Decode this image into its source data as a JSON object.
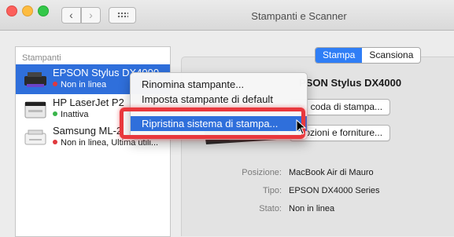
{
  "window": {
    "title": "Stampanti e Scanner"
  },
  "sidebar": {
    "header": "Stampanti",
    "printers": [
      {
        "name": "EPSON Stylus DX4000",
        "status": "Non in linea",
        "status_color": "#e0393e",
        "selected": true
      },
      {
        "name": "HP LaserJet P2",
        "status": "Inattiva",
        "status_color": "#39b54a",
        "selected": false
      },
      {
        "name": "Samsung ML-2",
        "status": "Non in linea, Ultima utili...",
        "status_color": "#e0393e",
        "selected": false
      }
    ]
  },
  "segmented": {
    "print_label": "Stampa",
    "scan_label": "Scansiona",
    "selected": "Stampa"
  },
  "detail": {
    "printer_name": "PSON Stylus DX4000",
    "open_queue_label": "pri coda di stampa...",
    "options_label": "Opzioni e forniture...",
    "location_label": "Posizione:",
    "location_value": "MacBook Air di Mauro",
    "type_label": "Tipo:",
    "type_value": "EPSON DX4000 Series",
    "state_label": "Stato:",
    "state_value": "Non in linea"
  },
  "context_menu": {
    "items": [
      {
        "label": "Rinomina stampante..."
      },
      {
        "label": "Imposta stampante di default"
      },
      {
        "label": "Ripristina sistema di stampa...",
        "highlighted": true
      }
    ]
  },
  "colors": {
    "selection": "#2f6fdb",
    "highlight_box": "#e8383d",
    "segment_on": "#2f7ef6"
  },
  "icons": [
    "back-chevron-icon",
    "forward-chevron-icon",
    "grid-icon",
    "printer-icon",
    "cursor-icon"
  ]
}
